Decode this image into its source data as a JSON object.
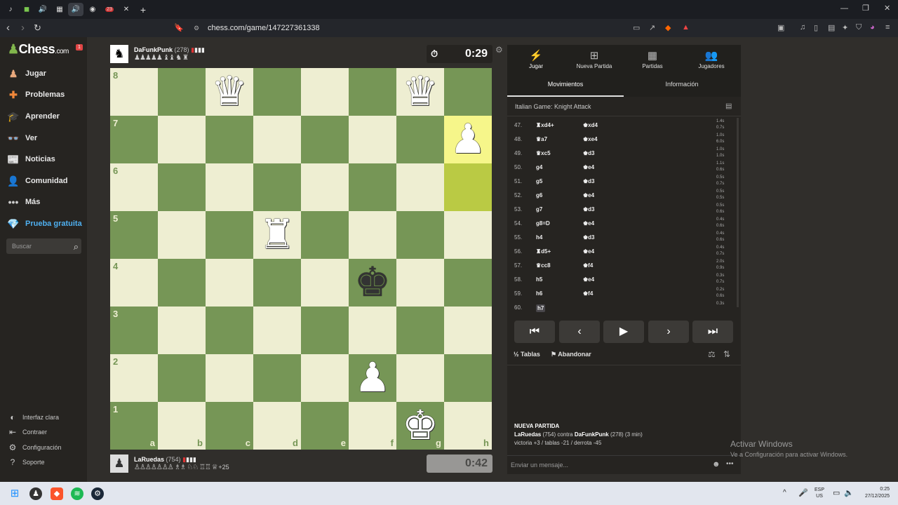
{
  "browser": {
    "url": "chess.com/game/147227361338",
    "tabs": [
      "tiktok",
      "duo",
      "audio",
      "grid",
      "audio-active",
      "chrome",
      "badge",
      "mute"
    ],
    "tab_badge": "23"
  },
  "sidebar": {
    "logo": "Chess",
    "logo_suffix": ".com",
    "notif": "1",
    "items": [
      {
        "label": "Jugar",
        "icon": "play-icon"
      },
      {
        "label": "Problemas",
        "icon": "puzzle-icon"
      },
      {
        "label": "Aprender",
        "icon": "learn-icon"
      },
      {
        "label": "Ver",
        "icon": "binoculars-icon"
      },
      {
        "label": "Noticias",
        "icon": "news-icon"
      },
      {
        "label": "Comunidad",
        "icon": "community-icon"
      },
      {
        "label": "Más",
        "icon": "more-icon"
      },
      {
        "label": "Prueba gratuita",
        "icon": "diamond-icon"
      }
    ],
    "search_placeholder": "Buscar",
    "bottom": [
      {
        "label": "Interfaz clara",
        "icon": "contrast-icon"
      },
      {
        "label": "Contraer",
        "icon": "collapse-icon"
      },
      {
        "label": "Configuración",
        "icon": "gear-icon"
      },
      {
        "label": "Soporte",
        "icon": "help-icon"
      }
    ]
  },
  "top_player": {
    "name": "DaFunkPunk",
    "rating": "(278)",
    "captured": "♟♟♟♟♟ ♝♝ ♞ ♜",
    "clock": "0:29"
  },
  "bottom_player": {
    "name": "LaRuedas",
    "rating": "(754)",
    "captured": "♙♙♙♙♙♙♙ ♗♗ ♘♘ ♖♖ ♕",
    "advantage": "+25",
    "clock": "0:42"
  },
  "board": {
    "ranks": [
      "8",
      "7",
      "6",
      "5",
      "4",
      "3",
      "2",
      "1"
    ],
    "files": [
      "a",
      "b",
      "c",
      "d",
      "e",
      "f",
      "g",
      "h"
    ],
    "pieces": [
      {
        "sq": "c8",
        "glyph": "♛",
        "color": "w",
        "name": "white-queen-c8"
      },
      {
        "sq": "g8",
        "glyph": "♛",
        "color": "w",
        "name": "white-queen-g8"
      },
      {
        "sq": "h7",
        "glyph": "♟",
        "color": "w",
        "name": "white-pawn-h7"
      },
      {
        "sq": "d5",
        "glyph": "♜",
        "color": "w",
        "name": "white-rook-d5"
      },
      {
        "sq": "f4",
        "glyph": "♚",
        "color": "b",
        "name": "black-king-f4"
      },
      {
        "sq": "f2",
        "glyph": "♟",
        "color": "w",
        "name": "white-pawn-f2"
      },
      {
        "sq": "g1",
        "glyph": "♚",
        "color": "w",
        "name": "white-king-g1"
      }
    ],
    "highlight": [
      "h7",
      "h6"
    ]
  },
  "panel": {
    "tabs": [
      {
        "label": "Jugar",
        "icon": "⚡"
      },
      {
        "label": "Nueva Partida",
        "icon": "⊞"
      },
      {
        "label": "Partidas",
        "icon": "▦"
      },
      {
        "label": "Jugadores",
        "icon": "👥"
      }
    ],
    "subtabs": [
      "Movimientos",
      "Información"
    ],
    "opening": "Italian Game: Knight Attack",
    "moves": [
      {
        "n": "47.",
        "w": "♜xd4+",
        "b": "♚xd4",
        "tw": "1.4s",
        "tb": "0.7s"
      },
      {
        "n": "48.",
        "w": "♛a7",
        "b": "♚xe4",
        "tw": "1.0s",
        "tb": "6.0s"
      },
      {
        "n": "49.",
        "w": "♛xc5",
        "b": "♚d3",
        "tw": "1.0s",
        "tb": "1.0s"
      },
      {
        "n": "50.",
        "w": "g4",
        "b": "♚e4",
        "tw": "1.1s",
        "tb": "0.6s"
      },
      {
        "n": "51.",
        "w": "g5",
        "b": "♚d3",
        "tw": "0.5s",
        "tb": "0.7s"
      },
      {
        "n": "52.",
        "w": "g6",
        "b": "♚e4",
        "tw": "0.5s",
        "tb": "0.5s"
      },
      {
        "n": "53.",
        "w": "g7",
        "b": "♚d3",
        "tw": "0.5s",
        "tb": "0.6s"
      },
      {
        "n": "54.",
        "w": "g8=D",
        "b": "♚e4",
        "tw": "0.4s",
        "tb": "0.6s"
      },
      {
        "n": "55.",
        "w": "h4",
        "b": "♚d3",
        "tw": "0.4s",
        "tb": "0.6s"
      },
      {
        "n": "56.",
        "w": "♜d5+",
        "b": "♚e4",
        "tw": "0.4s",
        "tb": "0.7s"
      },
      {
        "n": "57.",
        "w": "♛cc8",
        "b": "♚f4",
        "tw": "2.0s",
        "tb": "0.9s"
      },
      {
        "n": "58.",
        "w": "h5",
        "b": "♚e4",
        "tw": "0.3s",
        "tb": "0.7s"
      },
      {
        "n": "59.",
        "w": "h6",
        "b": "♚f4",
        "tw": "0.2s",
        "tb": "0.6s"
      },
      {
        "n": "60.",
        "w": "h7",
        "b": "",
        "tw": "0.3s",
        "tb": ""
      }
    ],
    "draw_label": "Tablas",
    "resign_label": "Abandonar",
    "newgame_title": "NUEVA PARTIDA",
    "newgame_p1": "LaRuedas",
    "newgame_p1r": "(754)",
    "newgame_vs": "contra",
    "newgame_p2": "DaFunkPunk",
    "newgame_p2r": "(278) (3 min)",
    "newgame_stats": "victoria +3 / tablas -21 / derrota -45",
    "message_placeholder": "Enviar un mensaje..."
  },
  "watermark": {
    "title": "Activar Windows",
    "sub": "Ve a Configuración para activar Windows."
  },
  "taskbar": {
    "lang": "ESP",
    "region": "US",
    "time": "0:25",
    "date": "27/12/2025"
  }
}
